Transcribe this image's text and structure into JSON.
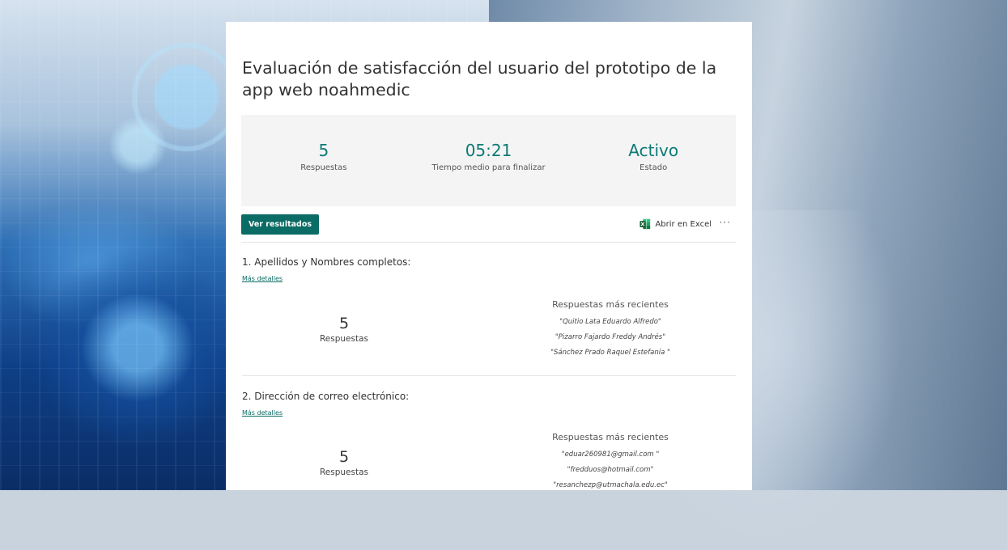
{
  "form": {
    "title": "Evaluación de satisfacción del usuario del prototipo de la app web noahmedic"
  },
  "stats": [
    {
      "value": "5",
      "label": "Respuestas"
    },
    {
      "value": "05:21",
      "label": "Tiempo medio para finalizar"
    },
    {
      "value": "Activo",
      "label": "Estado"
    }
  ],
  "toolbar": {
    "results_label": "Ver resultados",
    "excel_label": "Abrir en Excel",
    "more_label": "···"
  },
  "questions": [
    {
      "title": "1. Apellidos y Nombres completos:",
      "details_label": "Más detalles",
      "count": "5",
      "count_label": "Respuestas",
      "recent_title": "Respuestas más recientes",
      "recent": [
        "\"Quitio Lata Eduardo Alfredo\"",
        "\"Pizarro Fajardo Freddy Andrés\"",
        "\"Sánchez Prado Raquel Estefanía \""
      ]
    },
    {
      "title": "2. Dirección de correo electrónico:",
      "details_label": "Más detalles",
      "count": "5",
      "count_label": "Respuestas",
      "recent_title": "Respuestas más recientes",
      "recent": [
        "\"eduar260981@gmail.com \"",
        "\"fredduos@hotmail.com\"",
        "\"resanchezp@utmachala.edu.ec\""
      ]
    }
  ],
  "colors": {
    "accent": "#0b6b65",
    "stat_value": "#0b7a75",
    "excel_green": "#1e7145"
  }
}
